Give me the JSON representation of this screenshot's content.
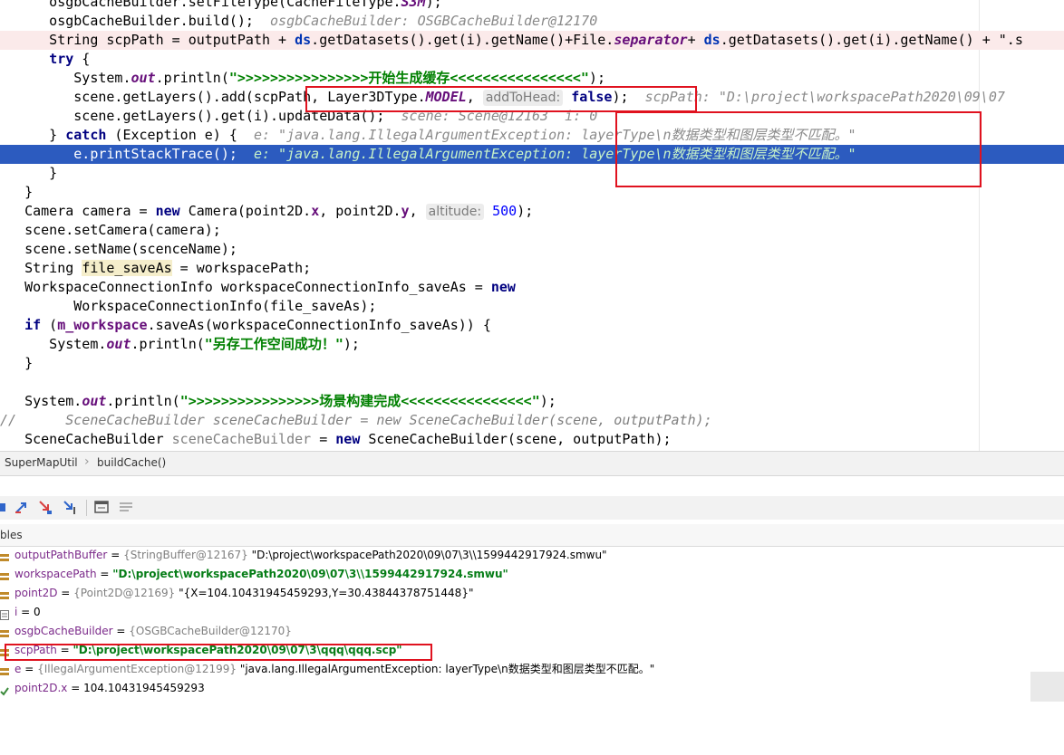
{
  "editor": {
    "line_0": {
      "a": "      osgbCacheBuilder.setFileType(CacheFileType.",
      "b": "S3M",
      "c": ");"
    },
    "line_1": {
      "a": "      osgbCacheBuilder.build();  ",
      "inline": "osgbCacheBuilder: OSGBCacheBuilder@12170"
    },
    "line_2": {
      "a": "      String scpPath = outputPath + ",
      "ds1": "ds",
      "b": ".getDatasets().get(i).getName()+File.",
      "sep": "separator",
      "c": "+ ",
      "ds2": "ds",
      "d": ".getDatasets().get(i).getName() + \".s"
    },
    "line_3": {
      "kw": "try",
      "a": " {"
    },
    "line_4": {
      "a": "         System.",
      "out": "out",
      "b": ".println(",
      "str": "\">>>>>>>>>>>>>>>>开始生成缓存<<<<<<<<<<<<<<<<\"",
      "c": ");"
    },
    "line_5": {
      "a": "         scene.getLayers().add(scpPath, Layer3DType.",
      "model": "MODEL",
      "b": ", ",
      "hint": "addToHead:",
      "kw": "false",
      "c": ");  ",
      "inline": "scpPath: \"D:\\project\\workspacePath2020\\09\\07"
    },
    "line_6": {
      "a": "         scene.getLayers().get(i).updateData();  ",
      "inline": "scene: Scene@12163  i: 0"
    },
    "line_7": {
      "a": "      } ",
      "kw": "catch",
      "b": " (Exception e) {  ",
      "inline": "e: \"java.lang.IllegalArgumentException: layerType\\n数据类型和图层类型不匹配。\""
    },
    "line_8": {
      "a": "         e.printStackTrace();  ",
      "inline": "e: \"java.lang.IllegalArgumentException: layerType\\n数据类型和图层类型不匹配。\""
    },
    "line_9": {
      "a": "      }"
    },
    "line_10": {
      "a": "   }"
    },
    "line_11": {
      "a": "   Camera camera = ",
      "kw": "new",
      "b": " Camera(point2D.",
      "x": "x",
      "c": ", point2D.",
      "y": "y",
      "d": ", ",
      "hint": "altitude:",
      "num": "500",
      "e": ");"
    },
    "line_12": {
      "a": "   scene.setCamera(camera);"
    },
    "line_13": {
      "a": "   scene.setName(scenceName);"
    },
    "line_14": {
      "a": "   String ",
      "var": "file_saveAs",
      "b": " = workspacePath;"
    },
    "line_15": {
      "a": "   WorkspaceConnectionInfo workspaceConnectionInfo_saveAs = ",
      "kw": "new"
    },
    "line_16": {
      "a": "         WorkspaceConnectionInfo(file_saveAs);"
    },
    "line_17": {
      "kw": "if",
      "a": " (",
      "fld": "m_workspace",
      "b": ".saveAs(workspaceConnectionInfo_saveAs)) {"
    },
    "line_18": {
      "a": "      System.",
      "out": "out",
      "b": ".println(",
      "str": "\"另存工作空间成功！\"",
      "c": ");"
    },
    "line_19": {
      "a": "   }"
    },
    "line_21": {
      "a": "   System.",
      "out": "out",
      "b": ".println(",
      "str": "\">>>>>>>>>>>>>>>>场景构建完成<<<<<<<<<<<<<<<<\"",
      "c": ");"
    },
    "line_22": {
      "a": "//      SceneCacheBuilder sceneCacheBuilder = new SceneCacheBuilder(scene, outputPath);"
    },
    "line_23": {
      "a": "   SceneCacheBuilder ",
      "unused": "sceneCacheBuilder",
      "b": " = ",
      "kw": "new",
      "c": " SceneCacheBuilder(scene, outputPath);"
    }
  },
  "breadcrumb": {
    "class": "SuperMapUtil",
    "method": "buildCache()"
  },
  "variables": {
    "panel_title": "bles",
    "rows": [
      {
        "name": "outputPathBuffer",
        "eq": " = ",
        "type": "{StringBuffer@12167} ",
        "value": "\"D:\\project\\workspacePath2020\\09\\07\\3\\\\1599442917924.smwu\"",
        "bold": false
      },
      {
        "name": "workspacePath",
        "eq": " = ",
        "type": "",
        "value": "\"D:\\project\\workspacePath2020\\09\\07\\3\\\\1599442917924.smwu\"",
        "bold": true
      },
      {
        "name": "point2D",
        "eq": " = ",
        "type": "{Point2D@12169} ",
        "value": "\"{X=104.10431945459293,Y=30.43844378751448}\"",
        "bold": false
      },
      {
        "name": "i",
        "eq": " = ",
        "type": "",
        "value": "0",
        "bold": false
      },
      {
        "name": "osgbCacheBuilder",
        "eq": " = ",
        "type": "{OSGBCacheBuilder@12170}",
        "value": "",
        "bold": false
      },
      {
        "name": "scpPath",
        "eq": " = ",
        "type": "",
        "value": "\"D:\\project\\workspacePath2020\\09\\07\\3\\qqq\\qqq.scp\"",
        "bold": true
      },
      {
        "name": "e",
        "eq": " = ",
        "type": "{IllegalArgumentException@12199} ",
        "value": "\"java.lang.IllegalArgumentException: layerType\\n数据类型和图层类型不匹配。\"",
        "bold": false
      },
      {
        "name": "point2D.x",
        "eq": " = ",
        "type": "",
        "value": "104.10431945459293",
        "bold": false
      }
    ]
  },
  "colors": {
    "highlight_box": "#e0121f",
    "exec_line": "#2c5bbf"
  }
}
